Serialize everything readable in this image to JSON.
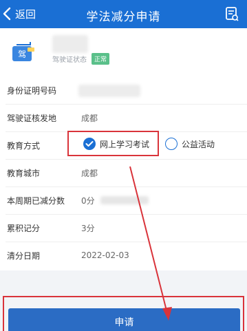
{
  "header": {
    "back_label": "返回",
    "title": "学法减分申请"
  },
  "profile": {
    "license_badge": "驾",
    "status_label": "驾驶证状态",
    "status_value": "正常"
  },
  "form": {
    "rows": [
      {
        "label": "身份证明号码",
        "value": ""
      },
      {
        "label": "驾驶证核发地",
        "value": "成都"
      },
      {
        "label": "教育方式",
        "options": [
          "网上学习考试",
          "公益活动"
        ],
        "selected": "网上学习考试"
      },
      {
        "label": "教育城市",
        "value": "成都"
      },
      {
        "label": "本周期已减分数",
        "value": "0分"
      },
      {
        "label": "累积记分",
        "value": "3分"
      },
      {
        "label": "清分日期",
        "value": "2022-02-03"
      }
    ]
  },
  "actions": {
    "apply_label": "申请"
  },
  "colors": {
    "brand": "#1a6fd4",
    "annotation": "#d9333a",
    "status_ok": "#5ac08a"
  }
}
